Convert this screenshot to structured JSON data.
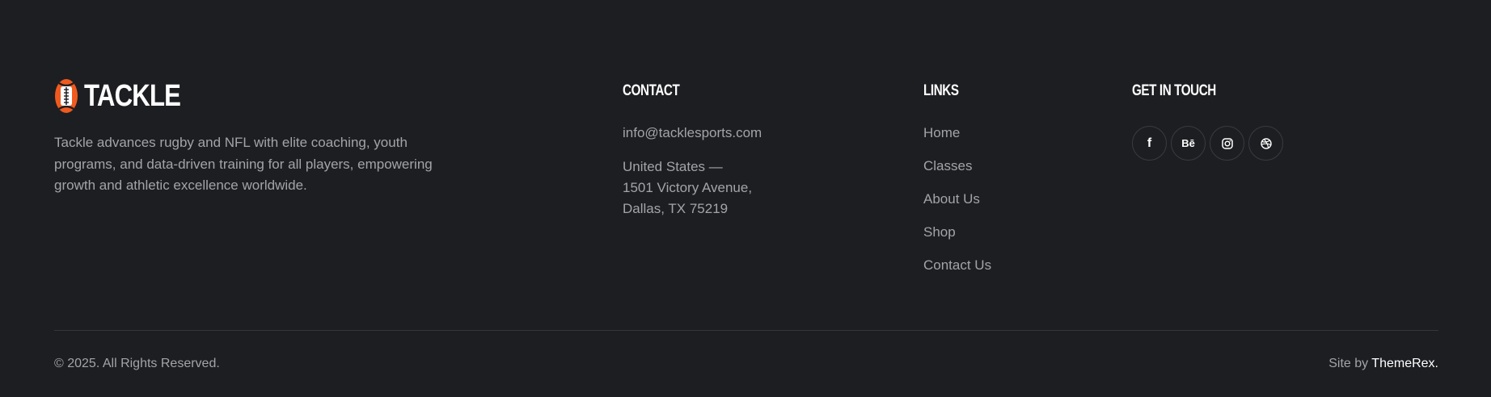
{
  "brand": {
    "name": "TACKLE",
    "description": "Tackle advances rugby and NFL with elite coaching, youth programs, and data-driven training for all players, empowering growth and athletic excellence worldwide.",
    "description_lines": [
      "Tackle advances rugby and NFL with elite coaching, youth",
      "programs, and data-driven training for all players, empowering",
      "growth and athletic excellence worldwide."
    ],
    "logo_icon": "football-icon",
    "accent": "#f05a1e"
  },
  "contact": {
    "heading": "CONTACT",
    "email": "info@tacklesports.com",
    "address": [
      "United States —",
      "1501 Victory Avenue,",
      "Dallas, TX 75219"
    ]
  },
  "links": {
    "heading": "LINKS",
    "items": [
      "Home",
      "Classes",
      "About Us",
      "Shop",
      "Contact Us"
    ]
  },
  "touch": {
    "heading": "GET IN TOUCH",
    "socials": [
      {
        "name": "facebook-icon",
        "glyph": "f"
      },
      {
        "name": "behance-icon",
        "glyph": "Bē"
      },
      {
        "name": "instagram-icon",
        "glyph": ""
      },
      {
        "name": "dribbble-icon",
        "glyph": ""
      }
    ]
  },
  "bottom": {
    "copyright": "© 2025. All Rights Reserved.",
    "siteby_prefix": "Site by ",
    "siteby_brand": "ThemeRex."
  },
  "colors": {
    "background": "#1d1e22",
    "text": "#a3a4a8",
    "heading": "#ffffff",
    "divider": "#35363b"
  }
}
